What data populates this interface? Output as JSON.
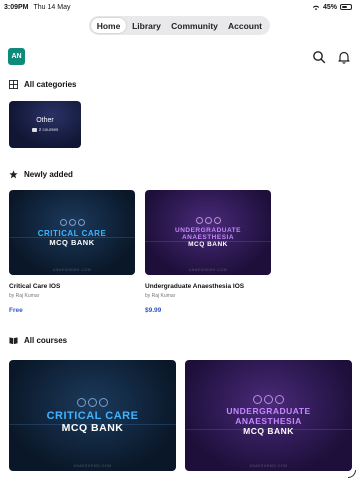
{
  "status_bar": {
    "time": "3:09PM",
    "date": "Thu 14 May",
    "battery": "45%"
  },
  "nav": {
    "tabs": [
      {
        "label": "Home",
        "active": true
      },
      {
        "label": "Library",
        "active": false
      },
      {
        "label": "Community",
        "active": false
      },
      {
        "label": "Account",
        "active": false
      }
    ]
  },
  "header": {
    "logo_text": "AN",
    "icons": [
      "search-icon",
      "bell-icon"
    ]
  },
  "sections": {
    "categories": {
      "title": "All categories",
      "icon": "grid-icon"
    },
    "newly_added": {
      "title": "Newly added",
      "icon": "star-icon"
    },
    "all_courses": {
      "title": "All courses",
      "icon": "book-icon"
    }
  },
  "categories": [
    {
      "title": "Other",
      "count": "2 courses"
    }
  ],
  "newly_added": [
    {
      "thumb_line1": "CRITICAL CARE",
      "thumb_line2": "MCQ BANK",
      "title": "Critical Care IOS",
      "author": "by Raj Kumar",
      "price": "Free"
    },
    {
      "thumb_line1": "UNDERGRADUATE ANAESTHESIA",
      "thumb_line2": "MCQ BANK",
      "title": "Undergraduate Anaesthesia IOS",
      "author": "by Raj Kumar",
      "price": "$9.99"
    }
  ],
  "all_courses": [
    {
      "thumb_line1": "CRITICAL CARE",
      "thumb_line2": "MCQ BANK"
    },
    {
      "thumb_line1": "UNDERGRADUATE ANAESTHESIA",
      "thumb_line2": "MCQ BANK"
    }
  ],
  "colors": {
    "accent": "#2f56c7",
    "logo": "#0d8a7a",
    "critical_care": "#3fb3ff",
    "anaesthesia": "#c687ff"
  }
}
